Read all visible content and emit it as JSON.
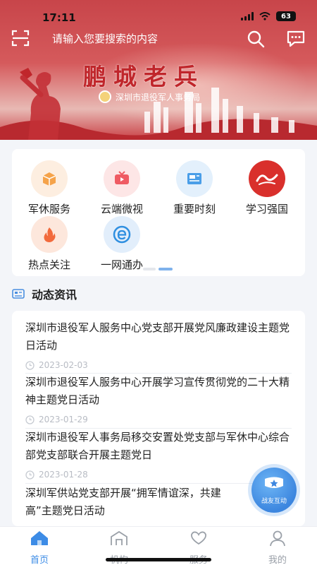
{
  "status": {
    "time": "17:11",
    "battery": "63"
  },
  "search": {
    "placeholder": "请输入您要搜索的内容"
  },
  "banner": {
    "title": "鹏城老兵",
    "subtitle": "深圳市退役军人事务局"
  },
  "grid": {
    "items": [
      {
        "label": "军休服务",
        "icon": "parcel-icon",
        "color": "#f5a34a"
      },
      {
        "label": "云端微视",
        "icon": "tv-icon",
        "color": "#ef5b63"
      },
      {
        "label": "重要时刻",
        "icon": "news-icon",
        "color": "#4a9ee8"
      },
      {
        "label": "学习强国",
        "icon": "xuexi-logo-icon",
        "color": "#d9302c"
      },
      {
        "label": "热点关注",
        "icon": "flame-icon",
        "color": "#f26a3c"
      },
      {
        "label": "一网通办",
        "icon": "e-service-icon",
        "color": "#2f8fe0"
      }
    ]
  },
  "news": {
    "heading": "动态资讯",
    "items": [
      {
        "title": "深圳市退役军人服务中心党支部开展党风廉政建设主题党日活动",
        "date": "2023-02-03"
      },
      {
        "title": "深圳市退役军人服务中心开展学习宣传贯彻党的二十大精神主题党日活动",
        "date": "2023-01-29"
      },
      {
        "title": "深圳市退役军人事务局移交安置处党支部与军休中心综合部党支部联合开展主题党日",
        "date": "2023-01-28"
      },
      {
        "title": "深圳军供站党支部开展“拥军情谊深，共建",
        "title_tail": "高”主题党日活动"
      }
    ]
  },
  "fab": {
    "label": "战友互动"
  },
  "tabs": [
    {
      "label": "首页",
      "icon": "home-icon",
      "active": true
    },
    {
      "label": "机构",
      "icon": "building-icon",
      "active": false
    },
    {
      "label": "服务",
      "icon": "heart-hands-icon",
      "active": false
    },
    {
      "label": "我的",
      "icon": "user-icon",
      "active": false
    }
  ],
  "colors": {
    "accent": "#3d8ce6",
    "banner": "#c8454a",
    "inactive": "#9aa0a8"
  }
}
